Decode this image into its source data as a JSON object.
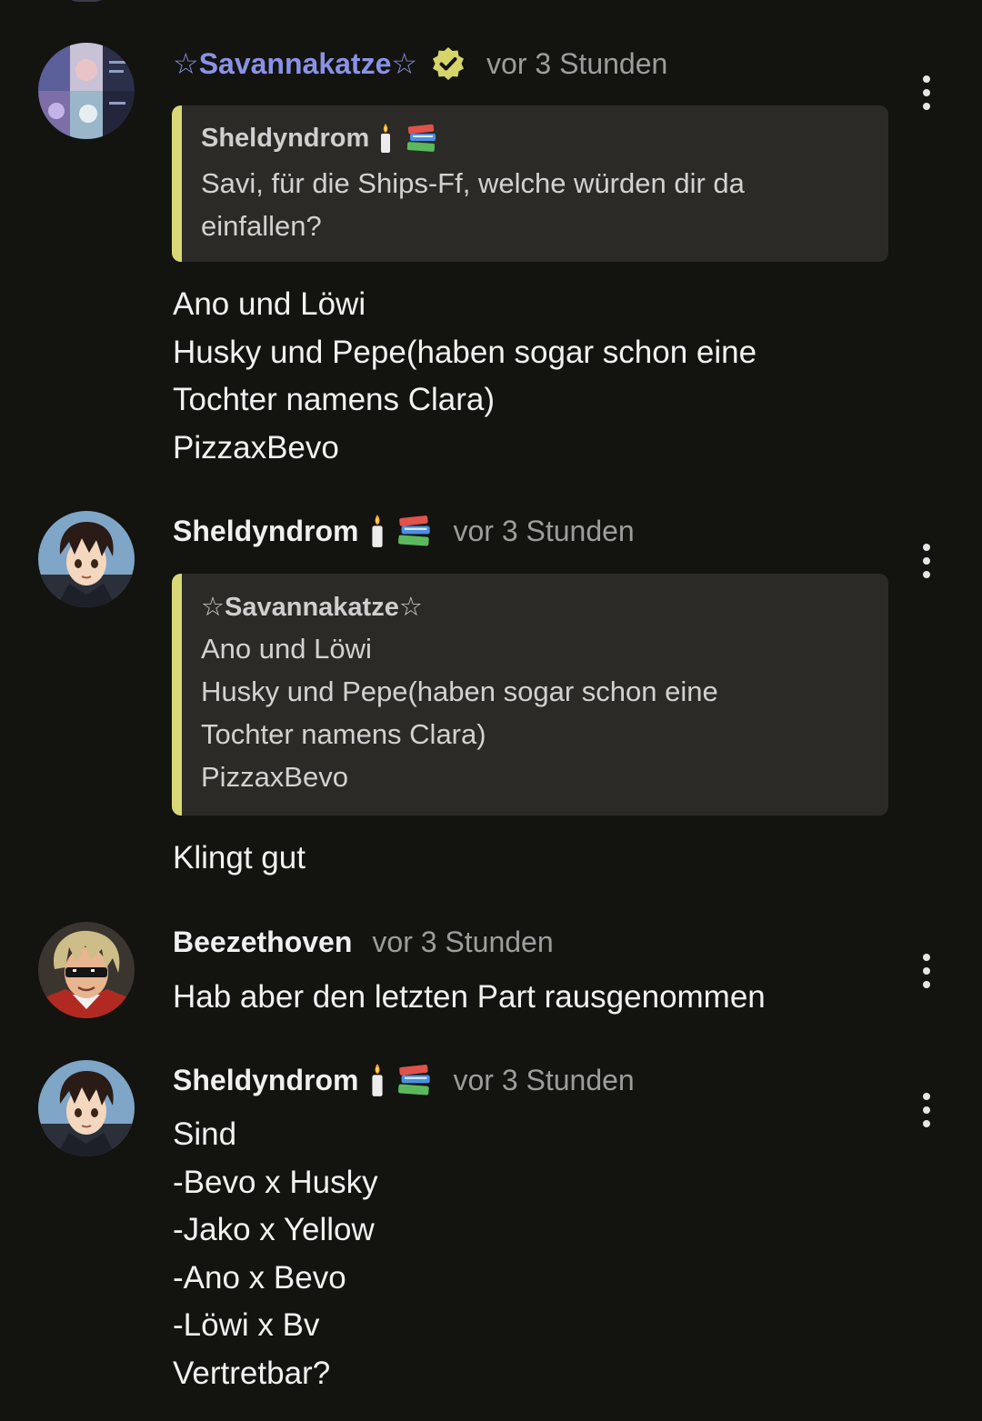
{
  "comments": [
    {
      "author": "☆Savannakatze☆",
      "timestamp": "vor 3 Stunden",
      "verified_icon": "verified-badge-icon",
      "quote": {
        "author": "Sheldyndrom",
        "author_icons": [
          "candle-icon",
          "books-icon"
        ],
        "lines": [
          "Savi, für die Ships-Ff, welche würden dir da",
          "einfallen?"
        ]
      },
      "lines": [
        "Ano und Löwi",
        "Husky und Pepe(haben sogar schon eine",
        "Tochter namens Clara)",
        "PizzaxBevo"
      ]
    },
    {
      "author": "Sheldyndrom",
      "author_icons": [
        "candle-icon",
        "books-icon"
      ],
      "timestamp": "vor 3 Stunden",
      "quote": {
        "author": "☆Savannakatze☆",
        "lines": [
          "Ano und Löwi",
          "Husky und Pepe(haben sogar schon eine",
          "Tochter namens Clara)",
          "PizzaxBevo"
        ]
      },
      "lines": [
        "Klingt gut"
      ]
    },
    {
      "author": "Beezethoven",
      "timestamp": "vor 3 Stunden",
      "lines": [
        "Hab aber den letzten Part rausgenommen"
      ]
    },
    {
      "author": "Sheldyndrom",
      "author_icons": [
        "candle-icon",
        "books-icon"
      ],
      "timestamp": "vor 3 Stunden",
      "lines": [
        "Sind",
        "-Bevo x Husky",
        "-Jako x Yellow",
        "-Ano x Bevo",
        "-Löwi x Bv",
        "Vertretbar?"
      ]
    }
  ],
  "colors": {
    "background": "#131310",
    "highlight_username": "#8a92e6",
    "quote_bar": "#d9d877",
    "quote_background": "#2b2a26",
    "verified_badge": "#d6d56a"
  }
}
